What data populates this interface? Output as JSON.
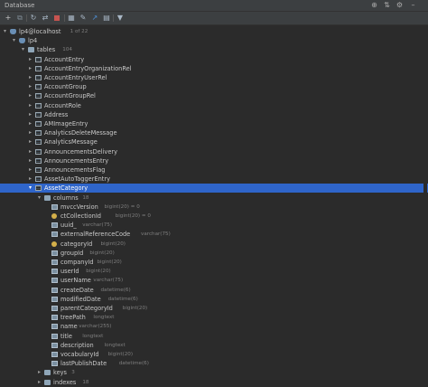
{
  "window": {
    "title": "Database"
  },
  "titlebar_icons": [
    "globe-icon",
    "split-icon",
    "gear-icon",
    "hide-icon"
  ],
  "toolbar": {
    "buttons": [
      "add-icon",
      "copy-icon",
      "refresh-icon",
      "schema-sync-icon",
      "stop-icon",
      "table-icon",
      "edit-icon",
      "jump-to-console-icon",
      "settings-icon",
      "filter-icon"
    ]
  },
  "tree": {
    "datasource": {
      "label": "lp4@localhost",
      "meta": "1 of 22"
    },
    "schema": {
      "label": "lp4"
    },
    "tables_folder": {
      "label": "tables",
      "meta": "104"
    },
    "tables": [
      "AccountEntry",
      "AccountEntryOrganizationRel",
      "AccountEntryUserRel",
      "AccountGroup",
      "AccountGroupRel",
      "AccountRole",
      "Address",
      "AMImageEntry",
      "AnalyticsDeleteMessage",
      "AnalyticsMessage",
      "AnnouncementsDelivery",
      "AnnouncementsEntry",
      "AnnouncementsFlag",
      "AssetAutoTaggerEntry",
      "AssetCategory"
    ],
    "selected_table": "AssetCategory",
    "columns_folder": {
      "label": "columns",
      "meta": "18"
    },
    "columns": [
      {
        "name": "mvccVersion",
        "type": "bigint(20) = 0",
        "key": false
      },
      {
        "name": "ctCollectionId",
        "type": "bigint(20) = 0",
        "key": true
      },
      {
        "name": "uuid_",
        "type": "varchar(75)",
        "key": false
      },
      {
        "name": "externalReferenceCode",
        "type": "varchar(75)",
        "key": false
      },
      {
        "name": "categoryId",
        "type": "bigint(20)",
        "key": true
      },
      {
        "name": "groupId",
        "type": "bigint(20)",
        "key": false
      },
      {
        "name": "companyId",
        "type": "bigint(20)",
        "key": false
      },
      {
        "name": "userId",
        "type": "bigint(20)",
        "key": false
      },
      {
        "name": "userName",
        "type": "varchar(75)",
        "key": false
      },
      {
        "name": "createDate",
        "type": "datetime(6)",
        "key": false
      },
      {
        "name": "modifiedDate",
        "type": "datetime(6)",
        "key": false
      },
      {
        "name": "parentCategoryId",
        "type": "bigint(20)",
        "key": false
      },
      {
        "name": "treePath",
        "type": "longtext",
        "key": false
      },
      {
        "name": "name",
        "type": "varchar(255)",
        "key": false
      },
      {
        "name": "title",
        "type": "longtext",
        "key": false
      },
      {
        "name": "description",
        "type": "longtext",
        "key": false
      },
      {
        "name": "vocabularyId",
        "type": "bigint(20)",
        "key": false
      },
      {
        "name": "lastPublishDate",
        "type": "datetime(6)",
        "key": false
      }
    ],
    "keys_folder": {
      "label": "keys",
      "meta": "3"
    },
    "indexes_folder": {
      "label": "indexes",
      "meta": "18"
    }
  },
  "colors": {
    "background": "#2b2b2b",
    "selection": "#2f65ca",
    "toolbar": "#3c3f41"
  }
}
